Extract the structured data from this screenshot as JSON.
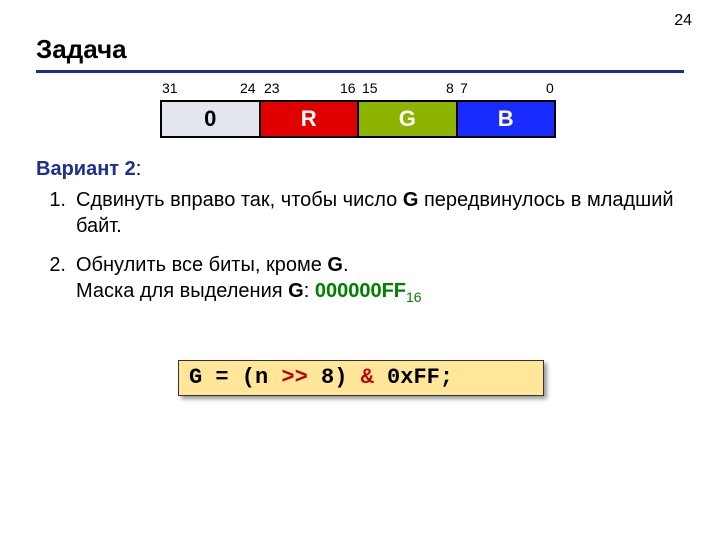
{
  "page_number": "24",
  "title": "Задача",
  "bit_labels": {
    "b31": "31",
    "b24": "24",
    "b23": "23",
    "b16": "16",
    "b15": "15",
    "b8": "8",
    "b7": "7",
    "b0": "0"
  },
  "bytes": {
    "zero": "0",
    "r": "R",
    "g": "G",
    "b": "B"
  },
  "variant": {
    "label": "Вариант 2",
    "colon": ":"
  },
  "steps": {
    "s1": {
      "num": "1.",
      "text_a": "Сдвинуть вправо так, чтобы число ",
      "g": "G",
      "text_b": " передвинулось в младший байт."
    },
    "s2": {
      "num": "2.",
      "text_a": "Обнулить все биты, кроме ",
      "g": "G",
      "text_b": ".",
      "line2a": "Маска для выделения ",
      "g2": "G",
      "line2b": ": ",
      "mask": "000000FF",
      "mask_sub": "16"
    }
  },
  "code": {
    "pre": "G = (n ",
    "shift": ">>",
    "mid": " 8) ",
    "amp": "&",
    "post": " 0xFF;"
  }
}
